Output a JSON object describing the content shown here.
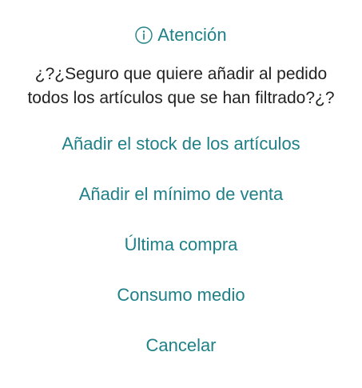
{
  "dialog": {
    "icon": "info-circle-icon",
    "title": "Atención",
    "message": "¿?¿Seguro que quiere añadir al pedido\ntodos los artículos que se han filtrado?¿?",
    "actions": [
      {
        "label": "Añadir el stock de los artículos"
      },
      {
        "label": "Añadir el mínimo de venta"
      },
      {
        "label": "Última compra"
      },
      {
        "label": "Consumo medio"
      },
      {
        "label": "Cancelar"
      }
    ],
    "accent_color": "#1f8088"
  }
}
